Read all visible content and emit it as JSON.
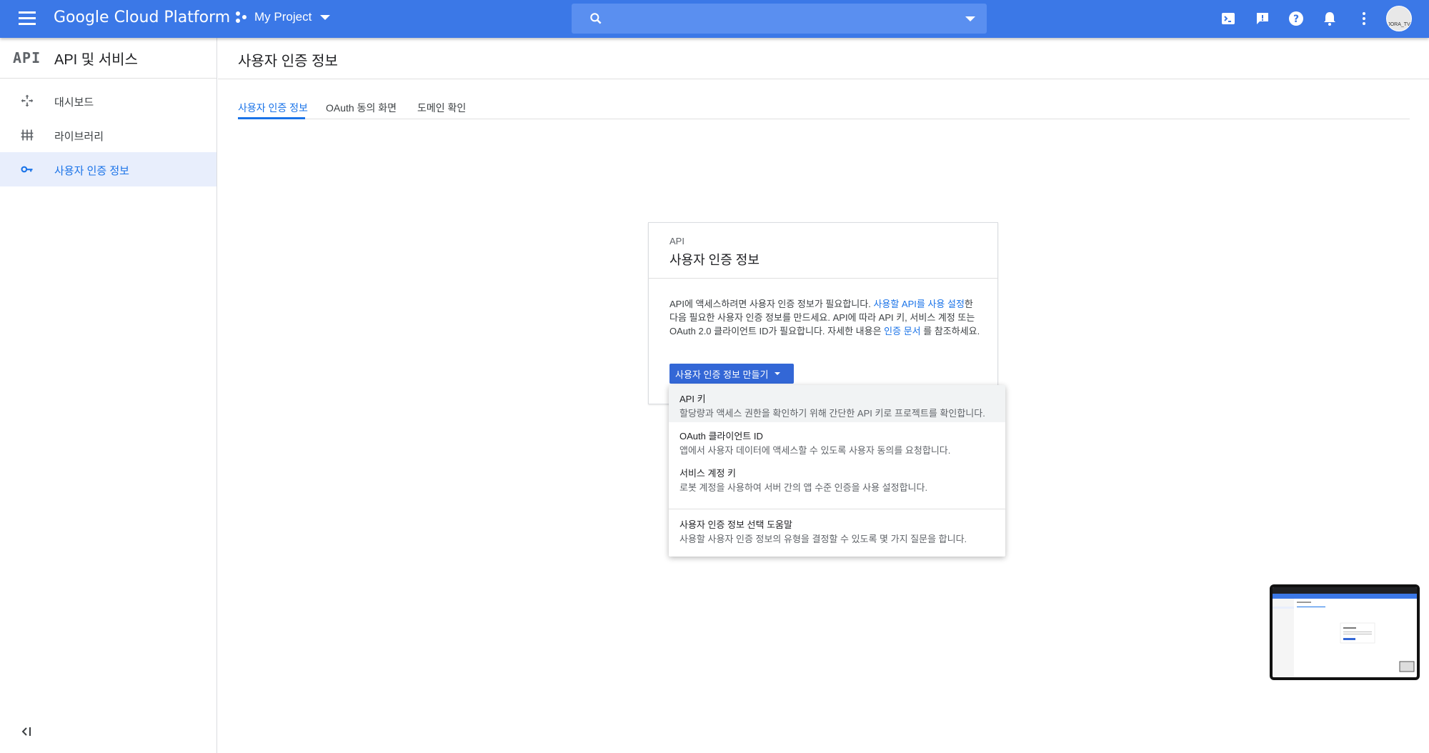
{
  "topbar": {
    "brand": "Google Cloud Platform",
    "project": "My Project",
    "search_placeholder": "",
    "avatar_label": "JORA_TV"
  },
  "sidebar": {
    "logo": "API",
    "title": "API 및 서비스",
    "items": [
      {
        "label": "대시보드",
        "icon": "dashboard-icon"
      },
      {
        "label": "라이브러리",
        "icon": "library-icon"
      },
      {
        "label": "사용자 인증 정보",
        "icon": "key-icon",
        "active": true
      }
    ]
  },
  "main": {
    "page_title": "사용자 인증 정보",
    "tabs": [
      {
        "label": "사용자 인증 정보",
        "active": true
      },
      {
        "label": "OAuth 동의 화면"
      },
      {
        "label": "도메인 확인"
      }
    ]
  },
  "card": {
    "kicker": "API",
    "title": "사용자 인증 정보",
    "body_1": "API에 액세스하려면 사용자 인증 정보가 필요합니다. ",
    "link_1": "사용할 API를 사용 설정",
    "body_2": "한 다음 필요한 사용자 인증 정보를 만드세요. API에 따라 API 키, 서비스 계정 또는 OAuth 2.0 클라이언트 ID가 필요합니다. 자세한 내용은 ",
    "link_2": "인증 문서",
    "body_3": " 를 참조하세요.",
    "button": "사용자 인증 정보 만들기"
  },
  "menu": {
    "items": [
      {
        "title": "API 키",
        "desc": "할당량과 액세스 권한을 확인하기 위해 간단한 API 키로 프로젝트를 확인합니다."
      },
      {
        "title": "OAuth 클라이언트 ID",
        "desc": "앱에서 사용자 데이터에 액세스할 수 있도록 사용자 동의를 요청합니다."
      },
      {
        "title": "서비스 계정 키",
        "desc": "로봇 계정을 사용하여 서버 간의 앱 수준 인증을 사용 설정합니다."
      },
      {
        "title": "사용자 인증 정보 선택 도움말",
        "desc": "사용할 사용자 인증 정보의 유형을 결정할 수 있도록 몇 가지 질문을 합니다."
      }
    ]
  },
  "colors": {
    "topbar": "#3b78e7",
    "accent": "#1a73e8",
    "button": "#3367d6"
  }
}
